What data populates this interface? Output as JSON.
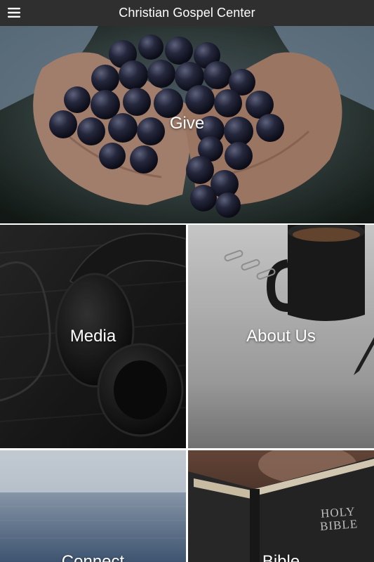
{
  "header": {
    "title": "Christian Gospel Center",
    "menu_icon": "hamburger-menu-icon"
  },
  "tiles": [
    {
      "label": "Give",
      "image": "hands-holding-grapes-photo"
    },
    {
      "label": "Media",
      "image": "headphones-photo"
    },
    {
      "label": "About Us",
      "image": "coffee-mug-and-paperclips-photo"
    },
    {
      "label": "Connect",
      "image": "sea-horizon-photo"
    },
    {
      "label": "Bible",
      "image": "holy-bible-book-photo"
    }
  ],
  "bible_cover_text": [
    "HOLY",
    "BIBLE"
  ],
  "colors": {
    "header_bg": "#2f2f2f",
    "label_text": "#ffffff"
  }
}
